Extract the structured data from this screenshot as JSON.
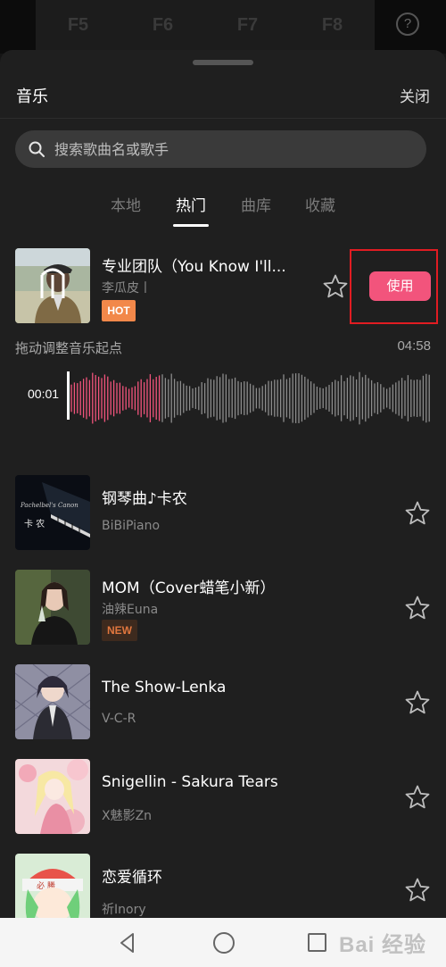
{
  "background_editor": {
    "function_keys": [
      "F5",
      "F6",
      "F7",
      "F8"
    ],
    "help_icon": "question-circle-icon"
  },
  "sheet": {
    "title": "音乐",
    "close_label": "关闭",
    "search": {
      "placeholder": "搜索歌曲名或歌手",
      "value": "",
      "icon": "search-icon"
    },
    "tabs": [
      {
        "label": "本地",
        "active": false
      },
      {
        "label": "热门",
        "active": true
      },
      {
        "label": "曲库",
        "active": false
      },
      {
        "label": "收藏",
        "active": false
      }
    ],
    "featured": {
      "title": "专业团队（You Know I'll...",
      "artist": "李瓜皮丨",
      "badge": "HOT",
      "use_label": "使用",
      "seek_hint": "拖动调整音乐起点",
      "duration": "04:58",
      "current_time": "00:01"
    },
    "tracks": [
      {
        "title": "钢琴曲♪卡农",
        "artist": "BiBiPiano",
        "badge": "",
        "cover_text": "卡 农"
      },
      {
        "title": "MOM（Cover蜡笔小新）",
        "artist": "油辣Euna",
        "badge": "NEW",
        "cover_text": ""
      },
      {
        "title": "The Show-Lenka",
        "artist": "V-C-R",
        "badge": "",
        "cover_text": ""
      },
      {
        "title": "Snigellin - Sakura Tears",
        "artist": "X魅影Zn",
        "badge": "",
        "cover_text": ""
      },
      {
        "title": "恋爱循环",
        "artist": "祈Inory",
        "badge": "",
        "cover_text": "必 勝"
      }
    ]
  },
  "nav_bar": {
    "watermark": "Bai 经验"
  },
  "colors": {
    "accent": "#f2547c",
    "hot_badge": "#f2884a",
    "new_badge_text": "#e0763e",
    "highlight_box": "#e11c22",
    "sheet_bg": "#1f1f1f"
  }
}
